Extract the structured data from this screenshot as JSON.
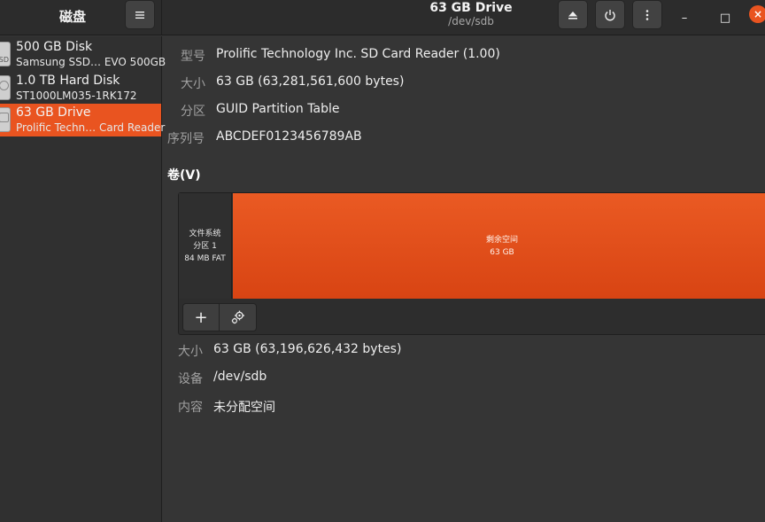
{
  "app": {
    "title": "磁盘"
  },
  "header": {
    "title": "63 GB Drive",
    "subtitle": "/dev/sdb",
    "menu_icon": "hamburger-menu-icon",
    "eject_icon": "eject-icon",
    "power_icon": "power-icon",
    "more_icon": "vertical-dots-icon"
  },
  "window_controls": {
    "minimize": "–",
    "maximize": "□",
    "close": "×"
  },
  "sidebar": {
    "items": [
      {
        "name": "500 GB Disk",
        "description": "Samsung SSD… EVO 500GB",
        "icon": "ssd-icon",
        "icon_label": "SD",
        "selected": false
      },
      {
        "name": "1.0 TB Hard Disk",
        "description": "ST1000LM035-1RK172",
        "icon": "hard-disk-icon",
        "selected": false
      },
      {
        "name": "63 GB Drive",
        "description": "Prolific Techn… Card Reader",
        "icon": "card-reader-icon",
        "selected": true
      }
    ]
  },
  "drive": {
    "model_label": "型号",
    "model": "Prolific Technology Inc. SD Card Reader (1.00)",
    "size_label": "大小",
    "size": "63 GB (63,281,561,600 bytes)",
    "partitioning_label": "分区",
    "partitioning": "GUID Partition Table",
    "serial_label": "序列号",
    "serial": "ABCDEF0123456789AB"
  },
  "volumes": {
    "heading": "卷(V)",
    "partitions": [
      {
        "line1": "文件系统",
        "line2": "分区 1",
        "line3": "84 MB FAT"
      },
      {
        "line1": "剩余空间",
        "line2": "63 GB"
      }
    ],
    "add_icon": "plus-icon",
    "add_glyph": "+",
    "settings_icon": "gears-icon"
  },
  "selected_volume": {
    "size_label": "大小",
    "size": "63 GB (63,196,626,432 bytes)",
    "device_label": "设备",
    "device": "/dev/sdb",
    "contents_label": "内容",
    "contents": "未分配空间"
  },
  "colors": {
    "accent": "#e95420",
    "background": "#353535",
    "sidebar": "#303030",
    "header": "#2c2c2c",
    "label": "#a0a0a0"
  }
}
